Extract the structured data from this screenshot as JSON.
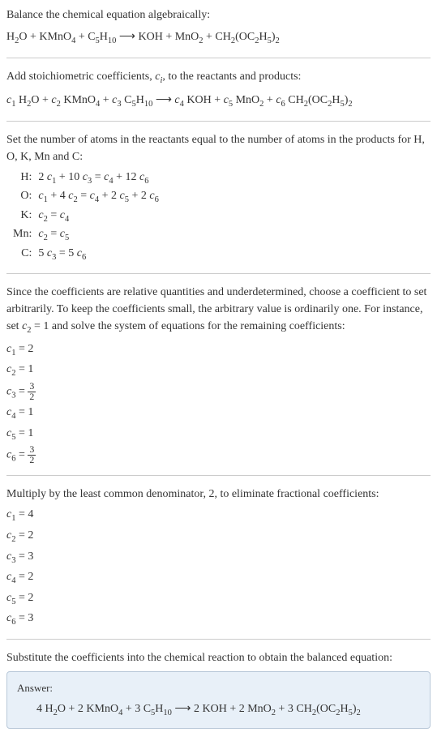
{
  "step1": {
    "text": "Balance the chemical equation algebraically:",
    "equation_html": "H<sub>2</sub>O + KMnO<sub>4</sub> + C<sub>5</sub>H<sub>10</sub> ⟶ KOH + MnO<sub>2</sub> + CH<sub>2</sub>(OC<sub>2</sub>H<sub>5</sub>)<sub>2</sub>"
  },
  "step2": {
    "text_html": "Add stoichiometric coefficients, <span class=\"italic\">c<sub>i</sub></span>, to the reactants and products:",
    "equation_html": "<span class=\"italic\">c</span><sub>1</sub> H<sub>2</sub>O + <span class=\"italic\">c</span><sub>2</sub> KMnO<sub>4</sub> + <span class=\"italic\">c</span><sub>3</sub> C<sub>5</sub>H<sub>10</sub> ⟶ <span class=\"italic\">c</span><sub>4</sub> KOH + <span class=\"italic\">c</span><sub>5</sub> MnO<sub>2</sub> + <span class=\"italic\">c</span><sub>6</sub> CH<sub>2</sub>(OC<sub>2</sub>H<sub>5</sub>)<sub>2</sub>"
  },
  "step3": {
    "text": "Set the number of atoms in the reactants equal to the number of atoms in the products for H, O, K, Mn and C:",
    "rows": [
      {
        "label": "H:",
        "value_html": "2 <span class=\"italic\">c</span><sub>1</sub> + 10 <span class=\"italic\">c</span><sub>3</sub> = <span class=\"italic\">c</span><sub>4</sub> + 12 <span class=\"italic\">c</span><sub>6</sub>"
      },
      {
        "label": "O:",
        "value_html": "<span class=\"italic\">c</span><sub>1</sub> + 4 <span class=\"italic\">c</span><sub>2</sub> = <span class=\"italic\">c</span><sub>4</sub> + 2 <span class=\"italic\">c</span><sub>5</sub> + 2 <span class=\"italic\">c</span><sub>6</sub>"
      },
      {
        "label": "K:",
        "value_html": "<span class=\"italic\">c</span><sub>2</sub> = <span class=\"italic\">c</span><sub>4</sub>"
      },
      {
        "label": "Mn:",
        "value_html": "<span class=\"italic\">c</span><sub>2</sub> = <span class=\"italic\">c</span><sub>5</sub>"
      },
      {
        "label": "C:",
        "value_html": "5 <span class=\"italic\">c</span><sub>3</sub> = 5 <span class=\"italic\">c</span><sub>6</sub>"
      }
    ]
  },
  "step4": {
    "text_html": "Since the coefficients are relative quantities and underdetermined, choose a coefficient to set arbitrarily. To keep the coefficients small, the arbitrary value is ordinarily one. For instance, set <span class=\"italic\">c</span><sub>2</sub> = 1 and solve the system of equations for the remaining coefficients:",
    "coefs": [
      {
        "html": "<span class=\"italic\">c</span><sub>1</sub> = 2"
      },
      {
        "html": "<span class=\"italic\">c</span><sub>2</sub> = 1"
      },
      {
        "html": "<span class=\"italic\">c</span><sub>3</sub> = <span class=\"frac\"><span class=\"num\">3</span><span class=\"den\">2</span></span>"
      },
      {
        "html": "<span class=\"italic\">c</span><sub>4</sub> = 1"
      },
      {
        "html": "<span class=\"italic\">c</span><sub>5</sub> = 1"
      },
      {
        "html": "<span class=\"italic\">c</span><sub>6</sub> = <span class=\"frac\"><span class=\"num\">3</span><span class=\"den\">2</span></span>"
      }
    ]
  },
  "step5": {
    "text": "Multiply by the least common denominator, 2, to eliminate fractional coefficients:",
    "coefs": [
      {
        "html": "<span class=\"italic\">c</span><sub>1</sub> = 4"
      },
      {
        "html": "<span class=\"italic\">c</span><sub>2</sub> = 2"
      },
      {
        "html": "<span class=\"italic\">c</span><sub>3</sub> = 3"
      },
      {
        "html": "<span class=\"italic\">c</span><sub>4</sub> = 2"
      },
      {
        "html": "<span class=\"italic\">c</span><sub>5</sub> = 2"
      },
      {
        "html": "<span class=\"italic\">c</span><sub>6</sub> = 3"
      }
    ]
  },
  "step6": {
    "text": "Substitute the coefficients into the chemical reaction to obtain the balanced equation:"
  },
  "answer": {
    "label": "Answer:",
    "equation_html": "4 H<sub>2</sub>O + 2 KMnO<sub>4</sub> + 3 C<sub>5</sub>H<sub>10</sub> ⟶ 2 KOH + 2 MnO<sub>2</sub> + 3 CH<sub>2</sub>(OC<sub>2</sub>H<sub>5</sub>)<sub>2</sub>"
  }
}
